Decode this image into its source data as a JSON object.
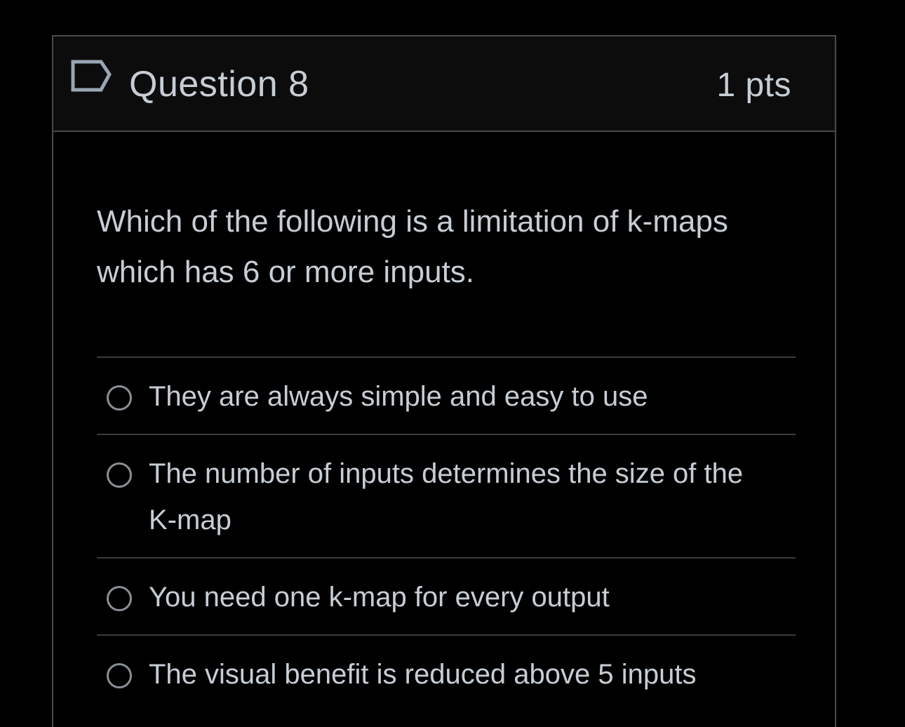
{
  "question": {
    "title": "Question 8",
    "points": "1 pts",
    "text": "Which of the following is a limitation of k-maps which has 6 or more inputs.",
    "flag_icon": "flag-icon"
  },
  "answers": [
    {
      "label": "They are always simple and easy to use"
    },
    {
      "label": "The number of inputs determines the size of the K-map"
    },
    {
      "label": "You need one k-map for every output"
    },
    {
      "label": "The visual benefit is reduced above 5 inputs"
    }
  ],
  "colors": {
    "background": "#000000",
    "header_background": "#0c0c0c",
    "text": "#c7cdd4",
    "border": "#4a4a4a",
    "radio_border": "#8a8f94"
  }
}
